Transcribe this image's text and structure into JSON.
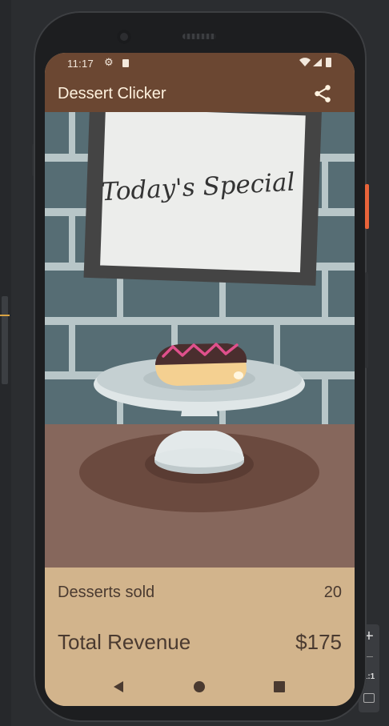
{
  "status_bar": {
    "time": "11:17",
    "icons": [
      "gear-icon",
      "sim-card-icon",
      "wifi-icon",
      "signal-icon",
      "battery-icon"
    ]
  },
  "app_bar": {
    "title": "Dessert Clicker",
    "share_icon": "share-icon"
  },
  "scene": {
    "sign_text": "Today's Special",
    "dessert": "eclair"
  },
  "stats": {
    "desserts_sold_label": "Desserts sold",
    "desserts_sold_value": "20",
    "total_revenue_label": "Total Revenue",
    "total_revenue_value": "$175"
  },
  "nav_bar": {
    "icons": [
      "back-icon",
      "home-icon",
      "recents-icon"
    ]
  },
  "emulator_toolbar": {
    "zoom_in": "+",
    "ratio": "1:1"
  },
  "colors": {
    "app_bar": "#6b4732",
    "info_panel": "#d2b48c",
    "text": "#4a3a30"
  }
}
